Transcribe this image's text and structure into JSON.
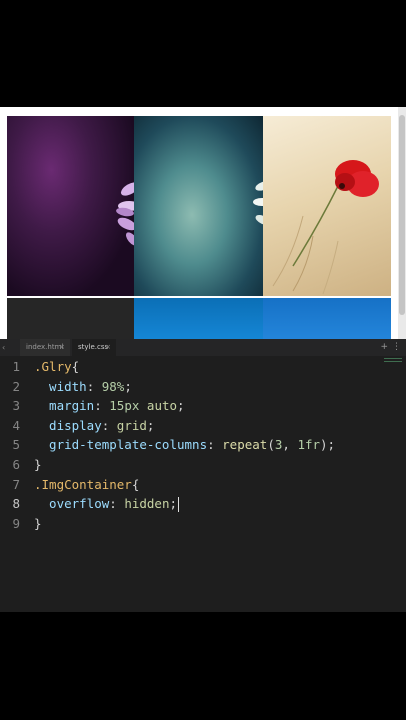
{
  "editor": {
    "tabs": [
      {
        "label": "index.html",
        "close": "×"
      },
      {
        "label": "style.css",
        "close": "×"
      }
    ],
    "new_tab_icon": "plus-icon",
    "more_icon": "more-icon",
    "active_line": 8,
    "lines": [
      {
        "n": "1",
        "segments": [
          {
            "t": ".Glry",
            "c": "sel"
          },
          {
            "t": "{",
            "c": "p"
          }
        ]
      },
      {
        "n": "2",
        "segments": [
          {
            "t": "  width",
            "c": "prop"
          },
          {
            "t": ": ",
            "c": "colon"
          },
          {
            "t": "98%",
            "c": "num"
          },
          {
            "t": ";",
            "c": "p"
          }
        ]
      },
      {
        "n": "3",
        "segments": [
          {
            "t": "  margin",
            "c": "prop"
          },
          {
            "t": ": ",
            "c": "colon"
          },
          {
            "t": "15px",
            "c": "num"
          },
          {
            "t": " ",
            "c": "p"
          },
          {
            "t": "auto",
            "c": "val"
          },
          {
            "t": ";",
            "c": "p"
          }
        ]
      },
      {
        "n": "4",
        "segments": [
          {
            "t": "  display",
            "c": "prop"
          },
          {
            "t": ": ",
            "c": "colon"
          },
          {
            "t": "grid",
            "c": "val"
          },
          {
            "t": ";",
            "c": "p"
          }
        ]
      },
      {
        "n": "5",
        "segments": [
          {
            "t": "  grid-template-columns",
            "c": "prop"
          },
          {
            "t": ": ",
            "c": "colon"
          },
          {
            "t": "repeat",
            "c": "fn"
          },
          {
            "t": "(",
            "c": "p"
          },
          {
            "t": "3",
            "c": "num"
          },
          {
            "t": ", ",
            "c": "p"
          },
          {
            "t": "1fr",
            "c": "num"
          },
          {
            "t": ");",
            "c": "p"
          }
        ]
      },
      {
        "n": "6",
        "segments": [
          {
            "t": "}",
            "c": "p"
          }
        ]
      },
      {
        "n": "7",
        "segments": [
          {
            "t": ".ImgContainer",
            "c": "sel"
          },
          {
            "t": "{",
            "c": "p"
          }
        ]
      },
      {
        "n": "8",
        "segments": [
          {
            "t": "  overflow",
            "c": "prop"
          },
          {
            "t": ": ",
            "c": "colon"
          },
          {
            "t": "hidden",
            "c": "val"
          },
          {
            "t": ";",
            "c": "p"
          }
        ]
      },
      {
        "n": "9",
        "segments": [
          {
            "t": "}",
            "c": "p"
          }
        ]
      }
    ]
  },
  "preview": {
    "gallery": [
      "purple-flower-image",
      "teal-blur-flower-image",
      "red-poppy-image",
      "dark-image",
      "blue-image",
      "blue-image-2"
    ]
  }
}
